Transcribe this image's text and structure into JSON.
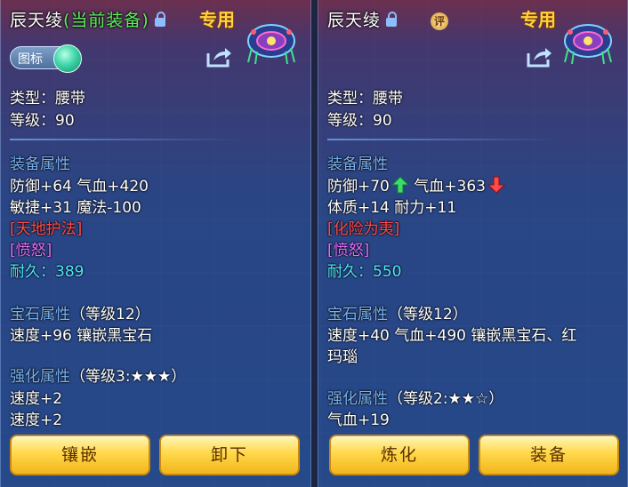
{
  "left": {
    "title_name": "辰天绫",
    "title_status": "(当前装备)",
    "special_tag": "专用",
    "icon_toggle_label": "图标",
    "type_line": "类型：腰带",
    "level_line": "等级：90",
    "equip_attr_header": "装备属性",
    "attr_line1": "防御+64 气血+420",
    "attr_line2": "敏捷+31 魔法-100",
    "skill": "[天地护法]",
    "special_effect": "[愤怒]",
    "durability_label": "耐久：",
    "durability_value": "389",
    "gem_header": "宝石属性",
    "gem_level": "（等级12）",
    "gem_line": "速度+96 镶嵌黑宝石",
    "enhance_header": "强化属性",
    "enhance_level": "（等级3:★★★）",
    "enhance_line1": "速度+2",
    "enhance_line2": "速度+2",
    "buttons": [
      "镶嵌",
      "卸下"
    ]
  },
  "right": {
    "title_name": "辰天绫",
    "rating_badge": "评",
    "special_tag": "专用",
    "type_line": "类型：腰带",
    "level_line": "等级：90",
    "equip_attr_header": "装备属性",
    "attr_line1_a": "防御+70",
    "attr_line1_b": "气血+363",
    "attr_line2": "体质+14 耐力+11",
    "skill": "[化险为夷]",
    "special_effect": "[愤怒]",
    "durability_label": "耐久：",
    "durability_value": "550",
    "gem_header": "宝石属性",
    "gem_level": "（等级12）",
    "gem_line1": "速度+40 气血+490 镶嵌黑宝石、红",
    "gem_line2": "玛瑙",
    "enhance_header": "强化属性",
    "enhance_level": "（等级2:★★☆）",
    "enhance_line1": "气血+19",
    "buttons": [
      "炼化",
      "装备"
    ]
  },
  "colors": {
    "title_status_green": "#5cf05a",
    "section_blue": "#7ab2ee",
    "skill_red": "#ff4a4a",
    "effect_purple": "#e46cff",
    "durability_cyan": "#4ee8ff",
    "special_gold": "#ffd23f",
    "button_gold": "#ffd84a"
  },
  "icons": {
    "lock": "lock-icon",
    "share": "share-icon",
    "increase": "arrow-up-icon",
    "decrease": "arrow-down-icon"
  }
}
